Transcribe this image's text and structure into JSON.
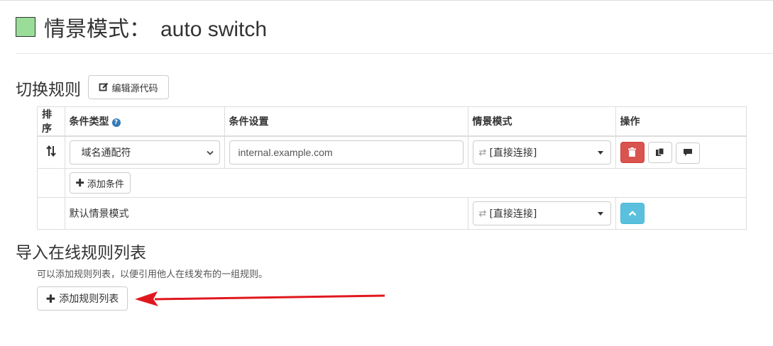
{
  "header": {
    "title_prefix": "情景模式：",
    "profile_name": "auto switch",
    "profile_color": "#99dd99"
  },
  "switch_rules": {
    "section_title": "切换规则",
    "edit_source_label": "编辑源代码",
    "columns": {
      "order": "排序",
      "condition_type": "条件类型",
      "condition_setting": "条件设置",
      "profile": "情景模式",
      "actions": "操作"
    },
    "rule": {
      "condition_type": "域名通配符",
      "condition_value": "internal.example.com",
      "profile": "[直接连接]"
    },
    "add_condition_label": "添加条件",
    "default_row": {
      "label": "默认情景模式",
      "profile": "[直接连接]"
    }
  },
  "import_rules": {
    "section_title": "导入在线规则列表",
    "description": "可以添加规则列表，以便引用他人在线发布的一组规则。",
    "add_list_label": "添加规则列表"
  },
  "colors": {
    "danger": "#d9534f",
    "info": "#5bc0de",
    "arrow": "#e0181e"
  }
}
